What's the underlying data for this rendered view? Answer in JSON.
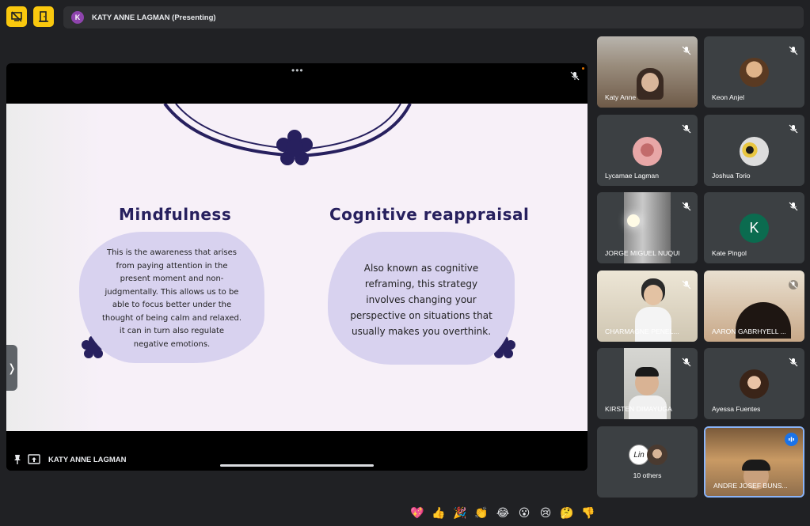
{
  "topbar": {
    "presenter_initial": "K",
    "presenter_label": "KATY ANNE LAGMAN (Presenting)"
  },
  "stage": {
    "footer_name": "KATY ANNE LAGMAN"
  },
  "slide": {
    "left_heading": "Mindfulness",
    "left_body": [
      "This is the awareness that arises",
      "from paying attention in the",
      "present moment and non-",
      "judgmentally. This allows us to be",
      "able to focus better under the",
      "thought of being calm and relaxed.",
      "it can in turn also regulate",
      "negative emotions."
    ],
    "right_heading": "Cognitive reappraisal",
    "right_body": [
      "Also known as cognitive",
      "reframing, this strategy",
      "involves changing your",
      "perspective on situations that",
      "usually makes you overthink."
    ]
  },
  "participants": [
    {
      "name": "Katy Anne"
    },
    {
      "name": "Keon Anjel"
    },
    {
      "name": "Lycamae Lagman"
    },
    {
      "name": "Joshua Torio"
    },
    {
      "name": "JORGE MIGUEL NUQUI"
    },
    {
      "name": "Kate Pingol",
      "initial": "K"
    },
    {
      "name": "CHARMAGNE PENEL..."
    },
    {
      "name": "AARON GABRHYELL ..."
    },
    {
      "name": "KIRSTEN DIMAYUGA"
    },
    {
      "name": "Ayessa Fuentes"
    },
    {
      "name": "10 others"
    },
    {
      "name": "ANDRE JOSEF BUNS..."
    }
  ],
  "reactions": [
    "💖",
    "👍",
    "🎉",
    "👏",
    "😂",
    "😮",
    "😢",
    "🤔",
    "👎"
  ],
  "colors": {
    "accent": "#f9c80e",
    "slide_ink": "#27205e",
    "blob": "#d8d2ef",
    "active_border": "#8ab4f8"
  }
}
